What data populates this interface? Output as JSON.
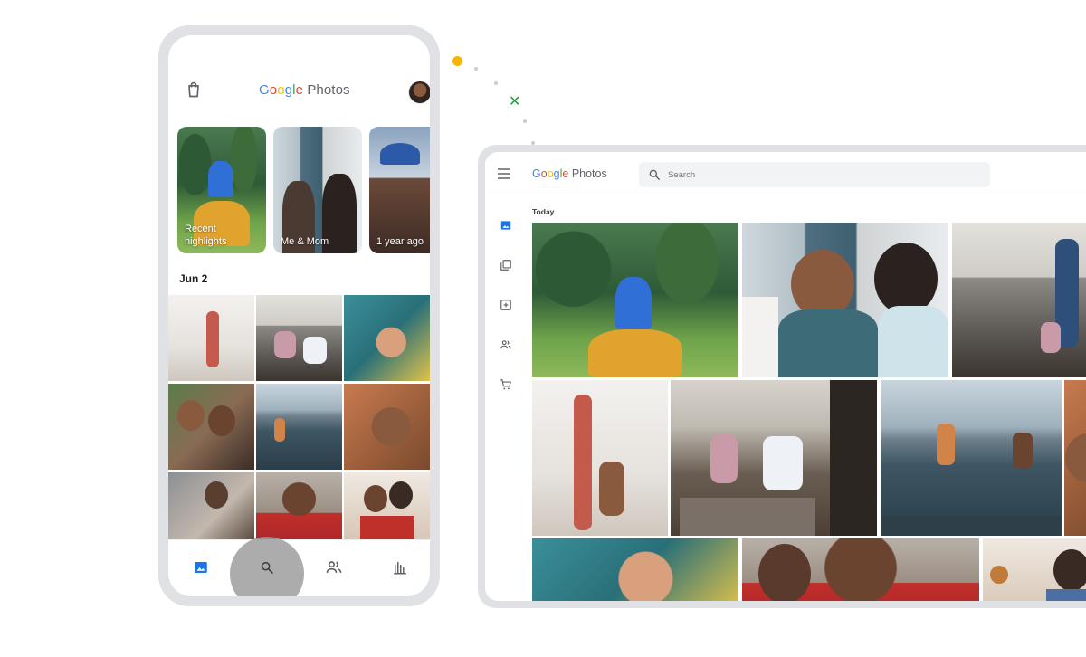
{
  "phone": {
    "logo": {
      "google": "Google",
      "photos": "Photos"
    },
    "icons": {
      "shop": "shopping-bag-icon",
      "avatar": "account-avatar"
    },
    "highlights": [
      {
        "label": "Recent highlights"
      },
      {
        "label": "Me & Mom"
      },
      {
        "label": "1 year ago"
      }
    ],
    "date_heading": "Jun 2",
    "nav": [
      {
        "name": "photos",
        "icon": "image-icon",
        "active": true
      },
      {
        "name": "search",
        "icon": "search-icon",
        "active": false
      },
      {
        "name": "sharing",
        "icon": "people-icon",
        "active": false
      },
      {
        "name": "library",
        "icon": "library-icon",
        "active": false
      }
    ]
  },
  "tablet": {
    "logo": {
      "google": "Google",
      "photos": "Photos"
    },
    "search": {
      "placeholder": "Search"
    },
    "sidebar": [
      {
        "name": "photos",
        "icon": "image-icon",
        "active": true
      },
      {
        "name": "albums",
        "icon": "albums-icon",
        "active": false
      },
      {
        "name": "utilities",
        "icon": "add-box-icon",
        "active": false
      },
      {
        "name": "sharing",
        "icon": "people-icon",
        "active": false
      },
      {
        "name": "print-store",
        "icon": "cart-icon",
        "active": false
      }
    ],
    "section_heading": "Today"
  },
  "colors": {
    "google_blue": "#4285F4",
    "google_red": "#EA4335",
    "google_yellow": "#FBBC05",
    "google_green": "#34A853",
    "accent": "#1A73E8",
    "deco_yellow": "#F7B500",
    "deco_green": "#1E9E3F"
  }
}
